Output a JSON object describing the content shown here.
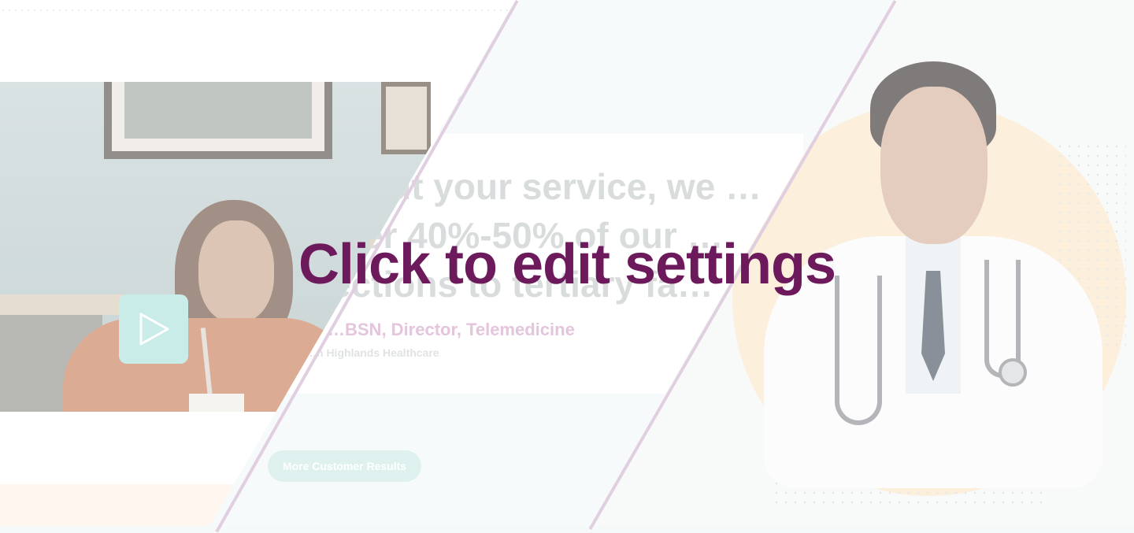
{
  "testimonial": {
    "quote_text": "…out your service, we …sfer 40%-50% of our …ections to tertiary fa…",
    "attribution_name": "…BSN, Director, Telemedicine",
    "attribution_org": "…n Highlands Healthcare"
  },
  "cta": {
    "more_results_label": "More Customer Results"
  },
  "video": {
    "play_icon": "play-icon"
  },
  "overlay": {
    "edit_settings_label": "Click to edit settings"
  },
  "colors": {
    "brand_purple": "#6d1a5c",
    "play_button_bg": "#c9ece9",
    "accent_peach": "#fbe6c8"
  }
}
